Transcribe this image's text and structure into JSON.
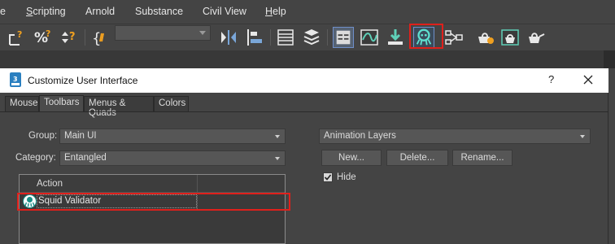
{
  "menubar": {
    "items": [
      {
        "label": "e"
      },
      {
        "prefix": "",
        "underline": "S",
        "suffix": "cripting"
      },
      {
        "label": "Arnold"
      },
      {
        "label": "Substance"
      },
      {
        "label": "Civil View"
      },
      {
        "prefix": "",
        "underline": "H",
        "suffix": "elp"
      }
    ]
  },
  "toolbar": {
    "icons": [
      "edit-named-selection-icon",
      "percent-snap-icon",
      "spinner-snap-icon",
      "curly-brace-icon",
      "named-selection-dropdown",
      "mirror-icon",
      "align-icon",
      "layer-explorer-icon",
      "toggle-layers-icon",
      "toggle-ribbon-icon",
      "curve-editor-icon",
      "schematic-view-icon",
      "squid-validator-icon",
      "material-editor-icon",
      "render-setup-icon",
      "rendered-frame-icon",
      "render-icon"
    ],
    "highlighted_icon": "squid-validator-icon",
    "highlight_color": "#e0201b"
  },
  "dialog": {
    "title": "Customize User Interface",
    "help": "?",
    "tabs": [
      "Mouse",
      "Toolbars",
      "Menus & Quads",
      "Colors"
    ],
    "active_tab": "Toolbars",
    "group_label": "Group:",
    "group_value": "Main UI",
    "category_label": "Category:",
    "category_value": "Entangled",
    "toolbar_select": "Animation Layers",
    "buttons": {
      "new": "New...",
      "delete": "Delete...",
      "rename": "Rename..."
    },
    "hide_label": "Hide",
    "hide_checked": true,
    "list": {
      "header": "Action",
      "rows": [
        {
          "label": "Squid Validator",
          "icon": "squid-icon"
        }
      ]
    }
  }
}
